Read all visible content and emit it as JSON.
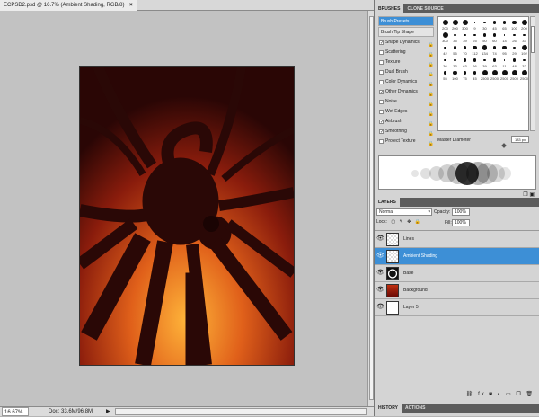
{
  "document": {
    "tab_title": "ECPSD2.psd @ 16.7% (Ambient Shading, RGB/8)",
    "close_symbol": "×",
    "zoom": "16.67%",
    "doc_size": "Doc: 33.6M/96.8M",
    "status_arrow": "▶"
  },
  "brushes_panel": {
    "tabs": [
      "BRUSHES",
      "CLONE SOURCE"
    ],
    "presets_label": "Brush Presets",
    "tip_shape_label": "Brush Tip Shape",
    "options": [
      {
        "label": "Shape Dynamics",
        "checked": true
      },
      {
        "label": "Scattering",
        "checked": false
      },
      {
        "label": "Texture",
        "checked": false
      },
      {
        "label": "Dual Brush",
        "checked": false
      },
      {
        "label": "Color Dynamics",
        "checked": false
      },
      {
        "label": "Other Dynamics",
        "checked": true
      },
      {
        "label": "Noise",
        "checked": false
      },
      {
        "label": "Wet Edges",
        "checked": false
      },
      {
        "label": "Airbrush",
        "checked": true
      },
      {
        "label": "Smoothing",
        "checked": true
      },
      {
        "label": "Protect Texture",
        "checked": false
      }
    ],
    "preset_sizes": [
      "200",
      "200",
      "300",
      "9",
      "30",
      "45",
      "65",
      "100",
      "200",
      "300",
      "35",
      "39",
      "25",
      "50",
      "60",
      "14",
      "26",
      "33",
      "42",
      "55",
      "70",
      "112",
      "134",
      "74",
      "95",
      "29",
      "192",
      "36",
      "33",
      "63",
      "66",
      "39",
      "63",
      "11",
      "48",
      "32",
      "55",
      "100",
      "75",
      "45",
      "2500",
      "2500",
      "2500",
      "2500",
      "2500"
    ],
    "master_diameter_label": "Master Diameter",
    "master_diameter_value": "183 px",
    "master_diameter_fraction": 0.73
  },
  "layers_panel": {
    "tab": "LAYERS",
    "blend_mode": "Normal",
    "opacity_label": "Opacity:",
    "opacity_value": "100%",
    "lock_label": "Lock:",
    "fill_label": "Fill:",
    "fill_value": "100%",
    "layers": [
      {
        "name": "Lines",
        "selected": false
      },
      {
        "name": "Ambient Shading",
        "selected": true
      },
      {
        "name": "Base",
        "selected": false
      },
      {
        "name": "Background",
        "selected": false
      },
      {
        "name": "Layer 5",
        "selected": false
      }
    ],
    "footer_icons": "⛓ fx ◙ ◐ ▭ ❒ 🗑"
  },
  "bottom_tabs": [
    "HISTORY",
    "ACTIONS"
  ]
}
